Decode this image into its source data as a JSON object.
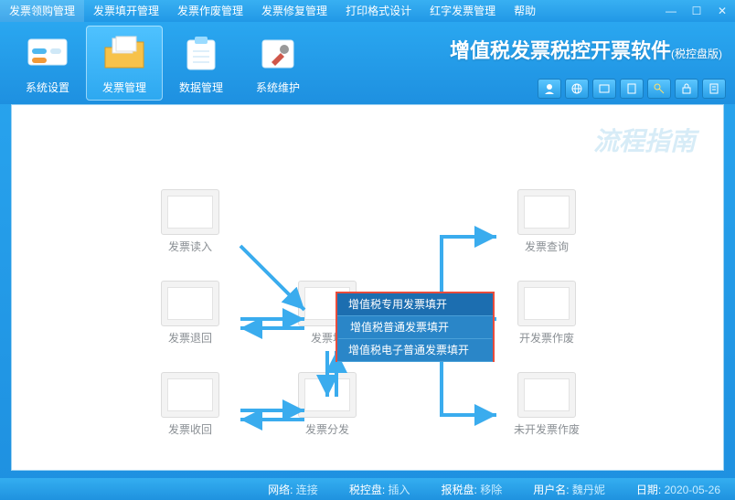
{
  "menus": [
    "发票领购管理",
    "发票填开管理",
    "发票作废管理",
    "发票修复管理",
    "打印格式设计",
    "红字发票管理",
    "帮助"
  ],
  "toolbar": {
    "system_settings": "系统设置",
    "invoice_mgmt": "发票管理",
    "data_mgmt": "数据管理",
    "system_maint": "系统维护"
  },
  "app_title": "增值税发票税控开票软件",
  "app_title_suffix": "(税控盘版)",
  "flow_title": "流程指南",
  "nodes": {
    "read": "发票读入",
    "return": "发票退回",
    "takeback": "发票收回",
    "fill": "发票填",
    "distribute": "发票分发",
    "query": "发票查询",
    "void_open": "开发票作废",
    "void_unopen": "未开发票作废"
  },
  "popup": {
    "item1": "增值税专用发票填开",
    "item2": "增值税普通发票填开",
    "item3": "增值税电子普通发票填开"
  },
  "status": {
    "net_label": "网络:",
    "net_value": "连接",
    "tax_label": "税控盘:",
    "tax_value": "插入",
    "rep_label": "报税盘:",
    "rep_value": "移除",
    "user_label": "用户名:",
    "user_value": "魏丹妮",
    "date_label": "日期:",
    "date_value": "2020-05-26"
  }
}
